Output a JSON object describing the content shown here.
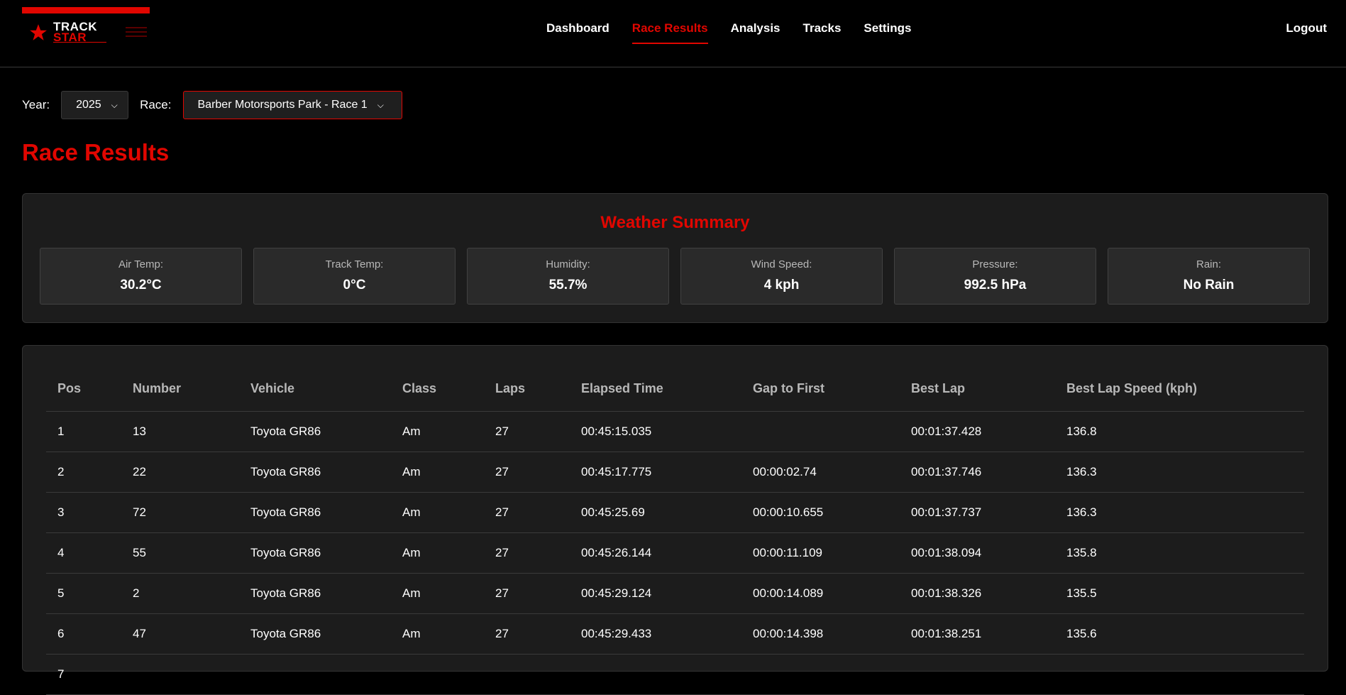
{
  "app": {
    "logo_line1": "TRACK",
    "logo_line2": "STAR"
  },
  "nav": {
    "items": [
      "Dashboard",
      "Race Results",
      "Analysis",
      "Tracks",
      "Settings"
    ],
    "active": "Race Results",
    "logout": "Logout"
  },
  "filters": {
    "year_label": "Year:",
    "year_value": "2025",
    "race_label": "Race:",
    "race_value": "Barber Motorsports Park - Race 1"
  },
  "page": {
    "title": "Race Results"
  },
  "weather": {
    "title": "Weather Summary",
    "items": [
      {
        "label": "Air Temp:",
        "value": "30.2°C"
      },
      {
        "label": "Track Temp:",
        "value": "0°C"
      },
      {
        "label": "Humidity:",
        "value": "55.7%"
      },
      {
        "label": "Wind Speed:",
        "value": "4 kph"
      },
      {
        "label": "Pressure:",
        "value": "992.5 hPa"
      },
      {
        "label": "Rain:",
        "value": "No Rain"
      }
    ]
  },
  "results": {
    "headers": [
      "Pos",
      "Number",
      "Vehicle",
      "Class",
      "Laps",
      "Elapsed Time",
      "Gap to First",
      "Best Lap",
      "Best Lap Speed (kph)"
    ],
    "rows": [
      [
        "1",
        "13",
        "Toyota GR86",
        "Am",
        "27",
        "00:45:15.035",
        "",
        "00:01:37.428",
        "136.8"
      ],
      [
        "2",
        "22",
        "Toyota GR86",
        "Am",
        "27",
        "00:45:17.775",
        "00:00:02.74",
        "00:01:37.746",
        "136.3"
      ],
      [
        "3",
        "72",
        "Toyota GR86",
        "Am",
        "27",
        "00:45:25.69",
        "00:00:10.655",
        "00:01:37.737",
        "136.3"
      ],
      [
        "4",
        "55",
        "Toyota GR86",
        "Am",
        "27",
        "00:45:26.144",
        "00:00:11.109",
        "00:01:38.094",
        "135.8"
      ],
      [
        "5",
        "2",
        "Toyota GR86",
        "Am",
        "27",
        "00:45:29.124",
        "00:00:14.089",
        "00:01:38.326",
        "135.5"
      ],
      [
        "6",
        "47",
        "Toyota GR86",
        "Am",
        "27",
        "00:45:29.433",
        "00:00:14.398",
        "00:01:38.251",
        "135.6"
      ],
      [
        "7",
        "",
        "",
        "",
        "",
        "",
        "",
        "",
        ""
      ]
    ]
  },
  "colors": {
    "accent": "#e10600",
    "background": "#000000",
    "card": "#1c1c1c",
    "tile": "#2a2a2a"
  }
}
